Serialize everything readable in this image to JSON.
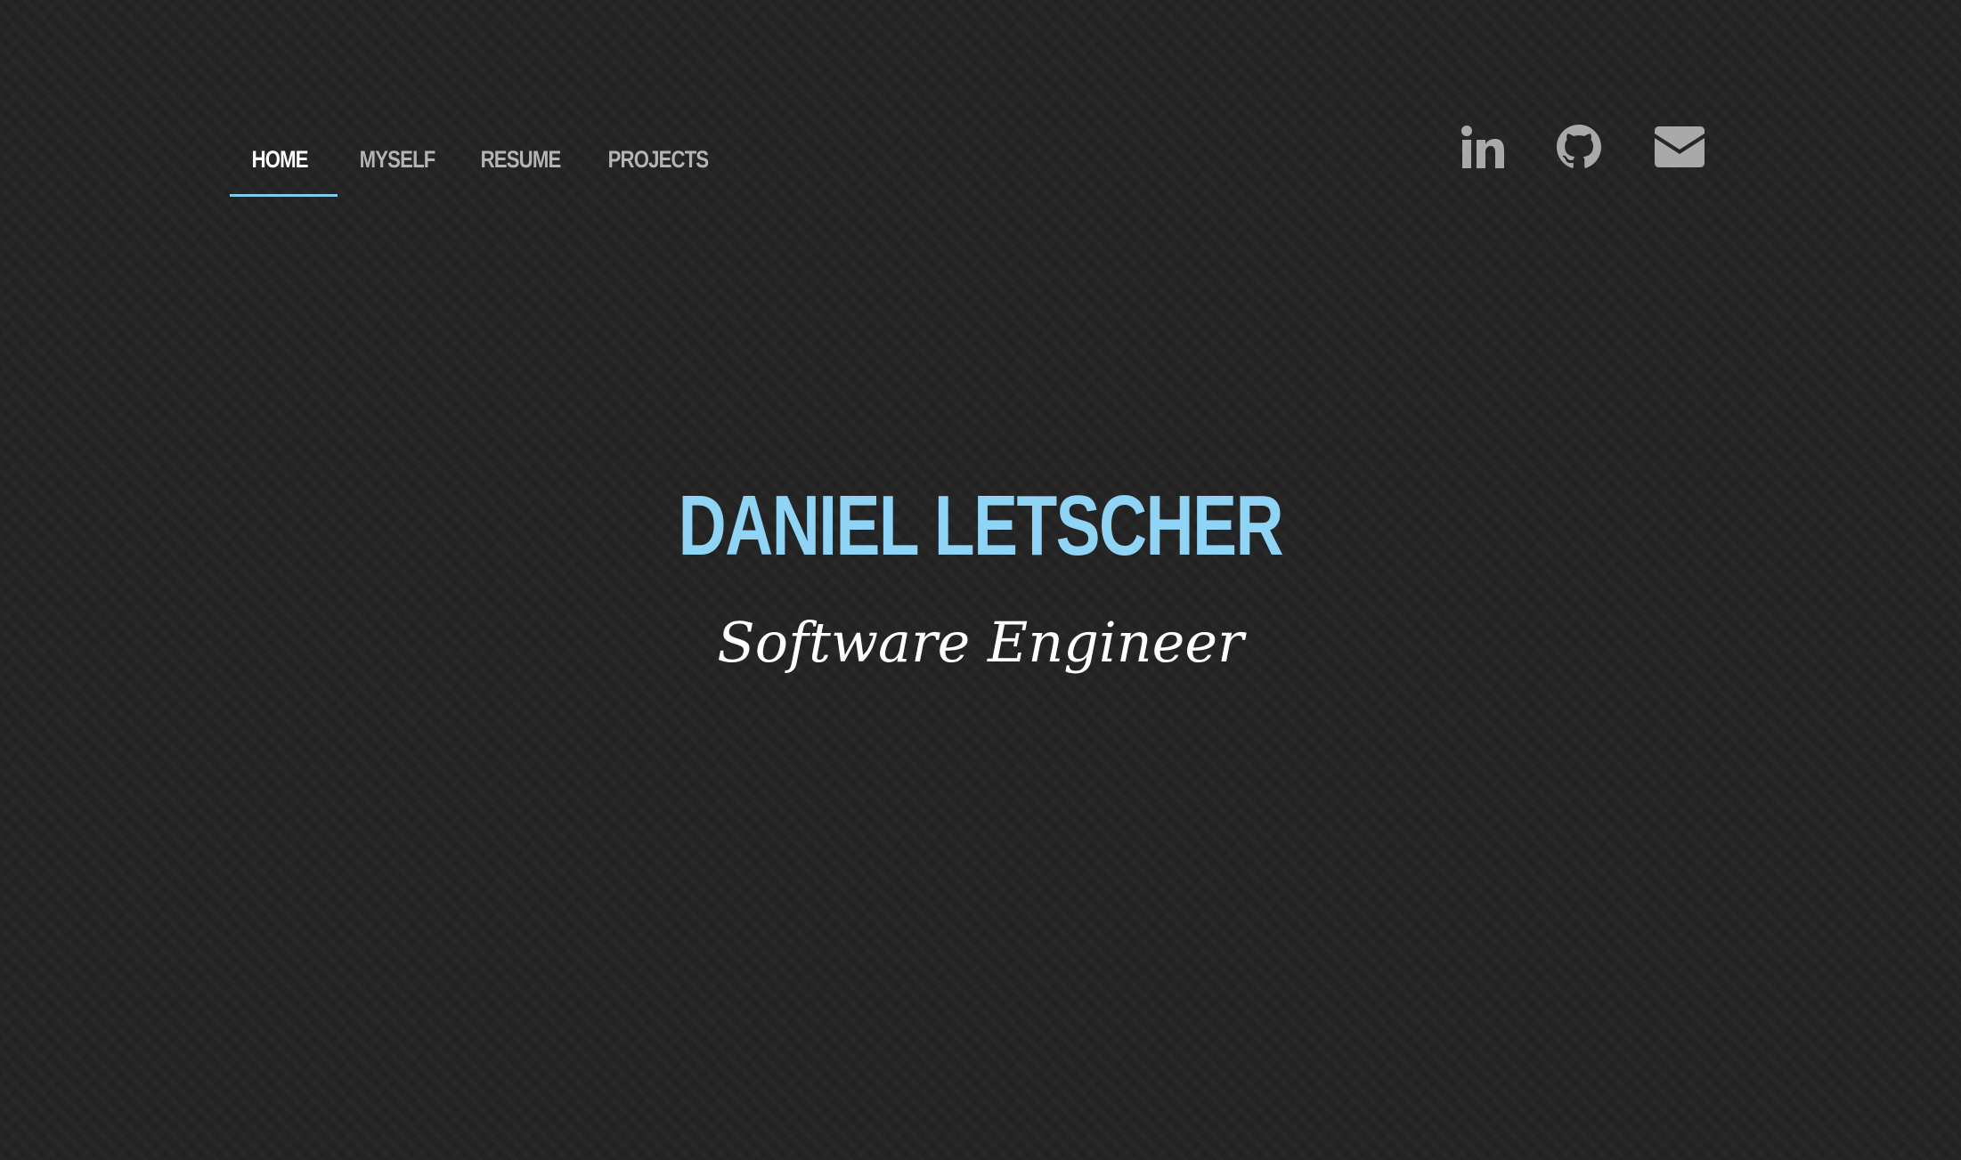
{
  "nav": {
    "items": [
      {
        "label": "HOME",
        "active": true
      },
      {
        "label": "MYSELF",
        "active": false
      },
      {
        "label": "RESUME",
        "active": false
      },
      {
        "label": "PROJECTS",
        "active": false
      }
    ]
  },
  "social": {
    "icons": [
      "linkedin-icon",
      "github-icon",
      "envelope-icon"
    ]
  },
  "hero": {
    "name": "DANIEL LETSCHER",
    "title": "Software Engineer"
  },
  "colors": {
    "background": "#242424",
    "accent": "#8fd3f5",
    "underline": "#7ecbea",
    "nav_inactive": "#b4b4b4",
    "icon": "#a9a9a9"
  }
}
